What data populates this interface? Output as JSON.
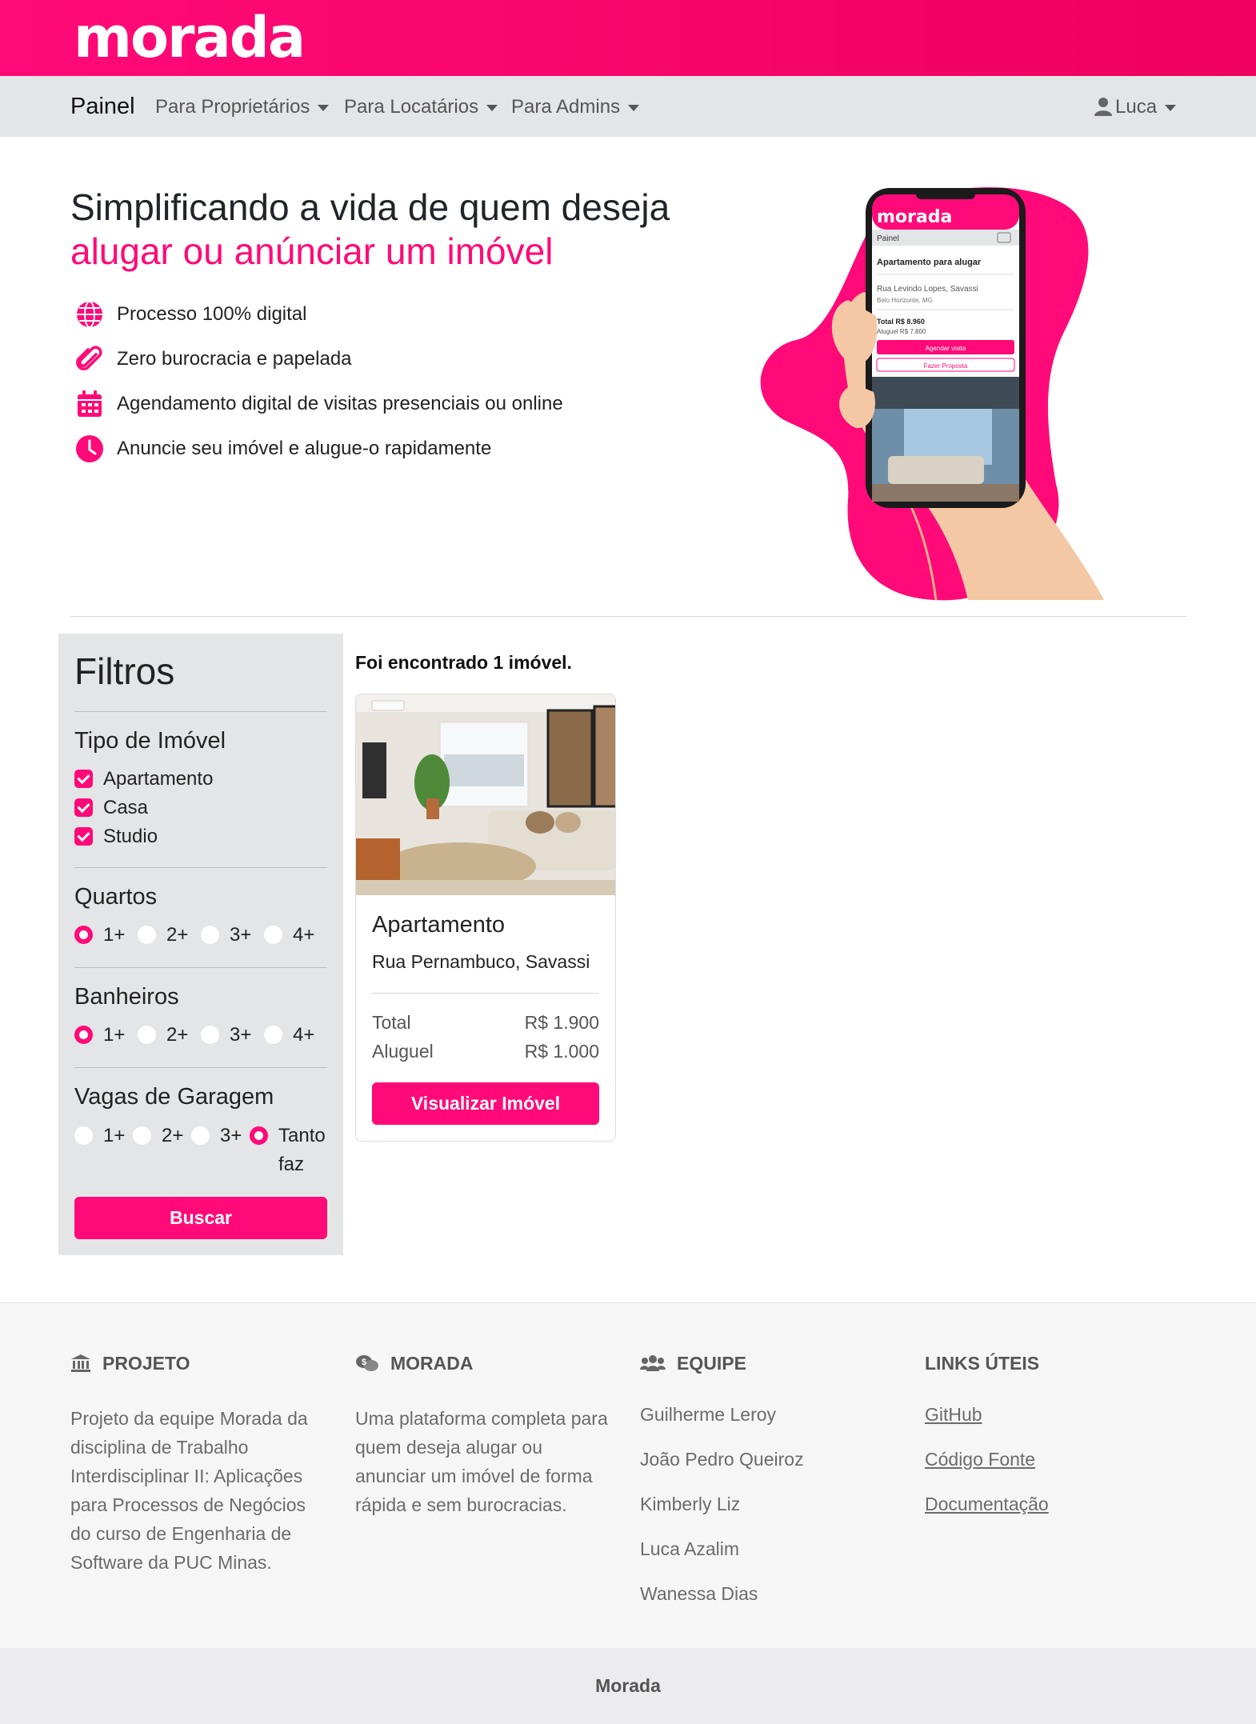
{
  "brand": {
    "logo": "morada",
    "accent_color": "#ff0a78"
  },
  "navbar": {
    "brand": "Painel",
    "items": [
      {
        "label": "Para Proprietários"
      },
      {
        "label": "Para Locatários"
      },
      {
        "label": "Para Admins"
      }
    ],
    "user": {
      "name": "Luca",
      "icon": "user-icon"
    }
  },
  "hero": {
    "title": "Simplificando a vida de quem deseja",
    "title_accent": "alugar ou anúnciar um imóvel",
    "features": [
      {
        "icon": "globe-icon",
        "text": "Processo 100% digital"
      },
      {
        "icon": "paperclip-icon",
        "text": "Zero burocracia e papelada"
      },
      {
        "icon": "calendar-icon",
        "text": "Agendamento digital de visitas presenciais ou online"
      },
      {
        "icon": "clock-icon",
        "text": "Anuncie seu imóvel e alugue-o rapidamente"
      }
    ],
    "phone_mockup": {
      "logo": "morada",
      "nav": "Painel",
      "title": "Apartamento para alugar",
      "address": "Rua Levindo Lopes, Savassi",
      "city": "Belo Horizonte, MG",
      "total": "Total R$ 8.960",
      "rent": "Aluguel R$ 7.800",
      "schedule_button": "Agendar visita",
      "offer_button": "Fazer Proposta"
    }
  },
  "filters": {
    "title": "Filtros",
    "property_type": {
      "label": "Tipo de Imóvel",
      "options": [
        {
          "label": "Apartamento",
          "checked": true
        },
        {
          "label": "Casa",
          "checked": true
        },
        {
          "label": "Studio",
          "checked": true
        }
      ]
    },
    "bedrooms": {
      "label": "Quartos",
      "options": [
        "1+",
        "2+",
        "3+",
        "4+"
      ],
      "selected": "1+"
    },
    "bathrooms": {
      "label": "Banheiros",
      "options": [
        "1+",
        "2+",
        "3+",
        "4+"
      ],
      "selected": "1+"
    },
    "parking": {
      "label": "Vagas de Garagem",
      "options": [
        "1+",
        "2+",
        "3+",
        "Tanto faz"
      ],
      "selected": "Tanto faz"
    },
    "search_button": "Buscar"
  },
  "results": {
    "count_text": "Foi encontrado 1 imóvel.",
    "listings": [
      {
        "title": "Apartamento",
        "address": "Rua Pernambuco, Savassi",
        "total_label": "Total",
        "total_value": "R$ 1.900",
        "rent_label": "Aluguel",
        "rent_value": "R$ 1.000",
        "button": "Visualizar Imóvel"
      }
    ]
  },
  "footer": {
    "project": {
      "title": "PROJETO",
      "icon": "bank-icon",
      "text": "Projeto da equipe Morada da disciplina de Trabalho Interdisciplinar II: Aplicações para Processos de Negócios do curso de Engenharia de Software da PUC Minas."
    },
    "morada": {
      "title": "MORADA",
      "icon": "money-chat-icon",
      "text": "Uma plataforma completa para quem deseja alugar ou anunciar um imóvel de forma rápida e sem burocracias."
    },
    "team": {
      "title": "EQUIPE",
      "icon": "team-icon",
      "members": [
        "Guilherme Leroy",
        "João Pedro Queiroz",
        "Kimberly Liz",
        "Luca Azalim",
        "Wanessa Dias"
      ]
    },
    "links": {
      "title": "LINKS ÚTEIS",
      "items": [
        "GitHub",
        "Código Fonte",
        "Documentação"
      ]
    },
    "copyright": "Morada"
  }
}
